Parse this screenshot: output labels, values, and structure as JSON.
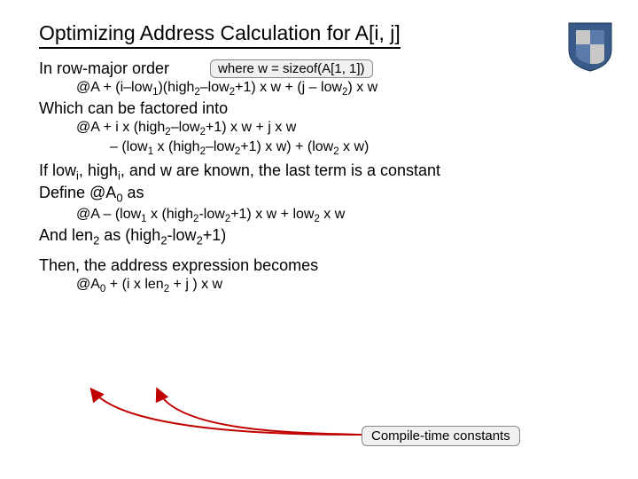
{
  "title": "Optimizing Address Calculation for A[i, j]",
  "whereNote": "where w = sizeof(A[1, 1])",
  "lines": {
    "rowMajor": "In row-major order",
    "formula1_html": "@A + (i–low<span class='sub'>1</span>)(high<span class='sub'>2</span>–low<span class='sub'>2</span>+1) x w + (j – low<span class='sub'>2</span>) x w",
    "factoredIntro": "Which can be factored into",
    "formula2a_html": "@A + i x (high<span class='sub'>2</span>–low<span class='sub'>2</span>+1) x w + j x w",
    "formula2b_html": "– (low<span class='sub'>1</span> x (high<span class='sub'>2</span>–low<span class='sub'>2</span>+1) x w) + (low<span class='sub'>2</span> x w)",
    "ifKnown_html": "If low<span class='sub'>i</span>, high<span class='sub'>i</span>, and w are known, the last term is a constant",
    "defineA0_html": "Define @A<span class='sub'>0</span> as",
    "formula3_html": "@A – (low<span class='sub'>1</span> x (high<span class='sub'>2</span>-low<span class='sub'>2</span>+1) x w + low<span class='sub'>2</span> x w",
    "andLen_html": "And len<span class='sub'>2</span> as (high<span class='sub'>2</span>-low<span class='sub'>2</span>+1)",
    "thenIntro": "Then, the address expression becomes",
    "finalFormula_html": "@A<span class='sub'>0</span> + (i x len<span class='sub'>2</span> + j ) x w"
  },
  "constBox": "Compile-time constants"
}
